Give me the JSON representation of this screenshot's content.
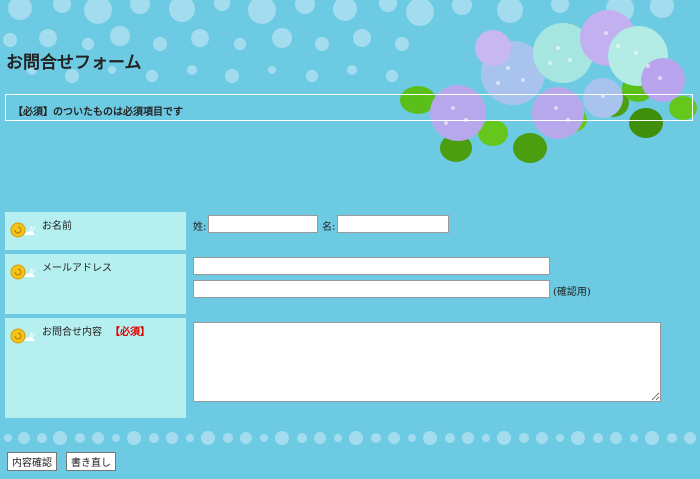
{
  "page": {
    "title": "お問合せフォーム"
  },
  "notice": {
    "text": "【必須】のついたものは必須項目です"
  },
  "form": {
    "name": {
      "label": "お名前",
      "last_prefix": "姓:",
      "first_prefix": "名:",
      "last_value": "",
      "first_value": ""
    },
    "email": {
      "label": "メールアドレス",
      "value": "",
      "confirm_value": "",
      "confirm_suffix": "(確認用)"
    },
    "message": {
      "label": "お問合せ内容",
      "required_tag": "【必須】",
      "value": ""
    }
  },
  "buttons": {
    "confirm": "内容確認",
    "reset": "書き直し"
  },
  "colors": {
    "background": "#6ccbe3",
    "label_cell": "#b6efef",
    "required": "#e00000",
    "dot": "#9edbee"
  }
}
